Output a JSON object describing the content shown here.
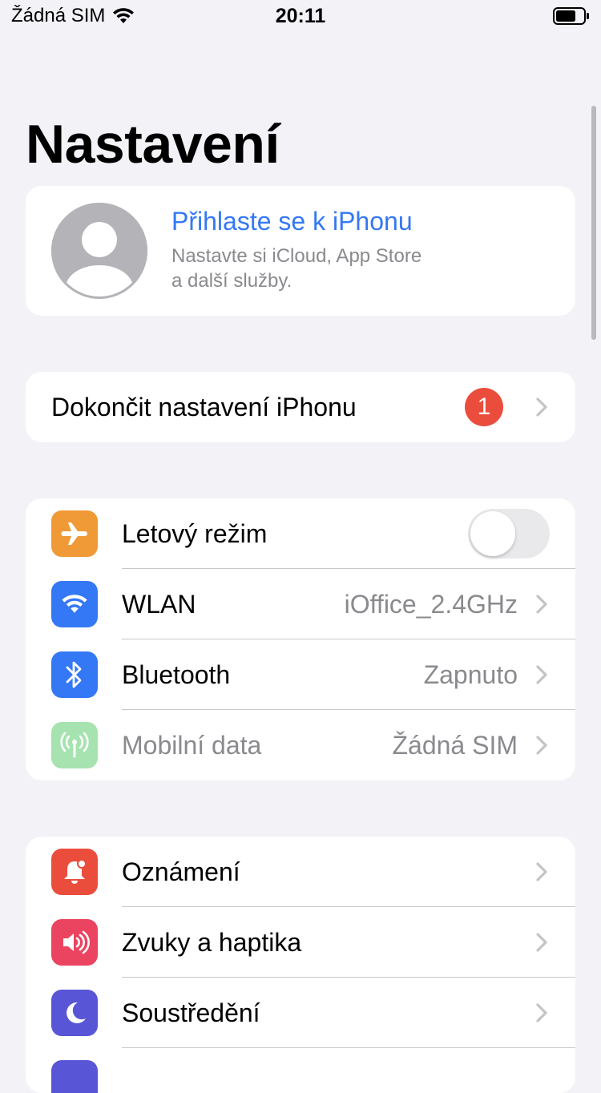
{
  "status_bar": {
    "carrier": "Žádná SIM",
    "time": "20:11"
  },
  "page": {
    "title": "Nastavení"
  },
  "profile": {
    "title": "Přihlaste se k iPhonu",
    "subtitle_line1": "Nastavte si iCloud, App Store",
    "subtitle_line2": "a další služby."
  },
  "setup": {
    "label": "Dokončit nastavení iPhonu",
    "badge": "1"
  },
  "connectivity": [
    {
      "label": "Letový režim",
      "icon": "airplane-icon",
      "color": "#f09a37",
      "control": "toggle",
      "on": false
    },
    {
      "label": "WLAN",
      "value": "iOffice_2.4GHz",
      "icon": "wifi-icon",
      "color": "#3478f6"
    },
    {
      "label": "Bluetooth",
      "value": "Zapnuto",
      "icon": "bluetooth-icon",
      "color": "#3478f6"
    },
    {
      "label": "Mobilní data",
      "value": "Žádná SIM",
      "icon": "antenna-icon",
      "color": "#a6e3b0",
      "disabled": true
    }
  ],
  "general": [
    {
      "label": "Oznámení",
      "icon": "bell-icon",
      "color": "#eb4d3d"
    },
    {
      "label": "Zvuky a haptika",
      "icon": "speaker-icon",
      "color": "#eb4461"
    },
    {
      "label": "Soustředění",
      "icon": "moon-icon",
      "color": "#5856d6"
    }
  ],
  "colors": {
    "accent": "#3478f6",
    "background": "#f2f2f7",
    "badge": "#eb4d3d"
  }
}
